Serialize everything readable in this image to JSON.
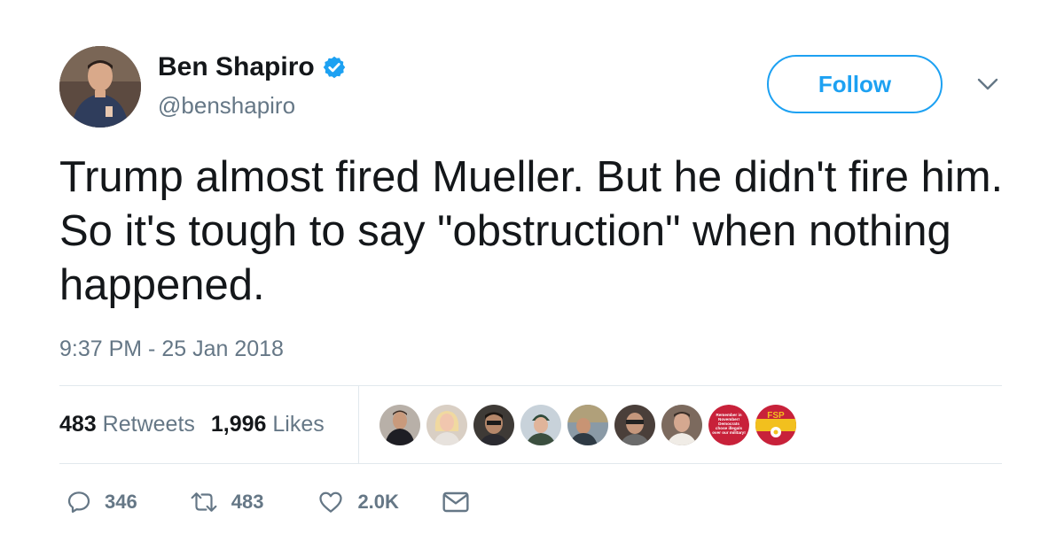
{
  "author": {
    "display_name": "Ben Shapiro",
    "handle": "@benshapiro",
    "verified": true
  },
  "follow_label": "Follow",
  "tweet": {
    "text": "Trump almost fired Mueller. But he didn't fire him. So it's tough to say \"obstruction\" when nothing happened.",
    "timestamp": "9:37 PM - 25 Jan 2018"
  },
  "stats": {
    "retweets_count": "483",
    "retweets_label": "Retweets",
    "likes_count": "1,996",
    "likes_label": "Likes"
  },
  "liker_avatars": {
    "badge_1_text": "Remember in November! Democrats chose illegals over our military!",
    "badge_2_text": "FSP"
  },
  "actions": {
    "replies": "346",
    "retweets": "483",
    "likes": "2.0K"
  },
  "colors": {
    "accent": "#1da1f2",
    "secondary_text": "#657786",
    "divider": "#e1e8ed"
  },
  "icons": {
    "verified": "verified-badge-icon",
    "caret": "chevron-down-icon",
    "reply": "reply-icon",
    "retweet": "retweet-icon",
    "like": "heart-icon",
    "message": "envelope-icon"
  }
}
